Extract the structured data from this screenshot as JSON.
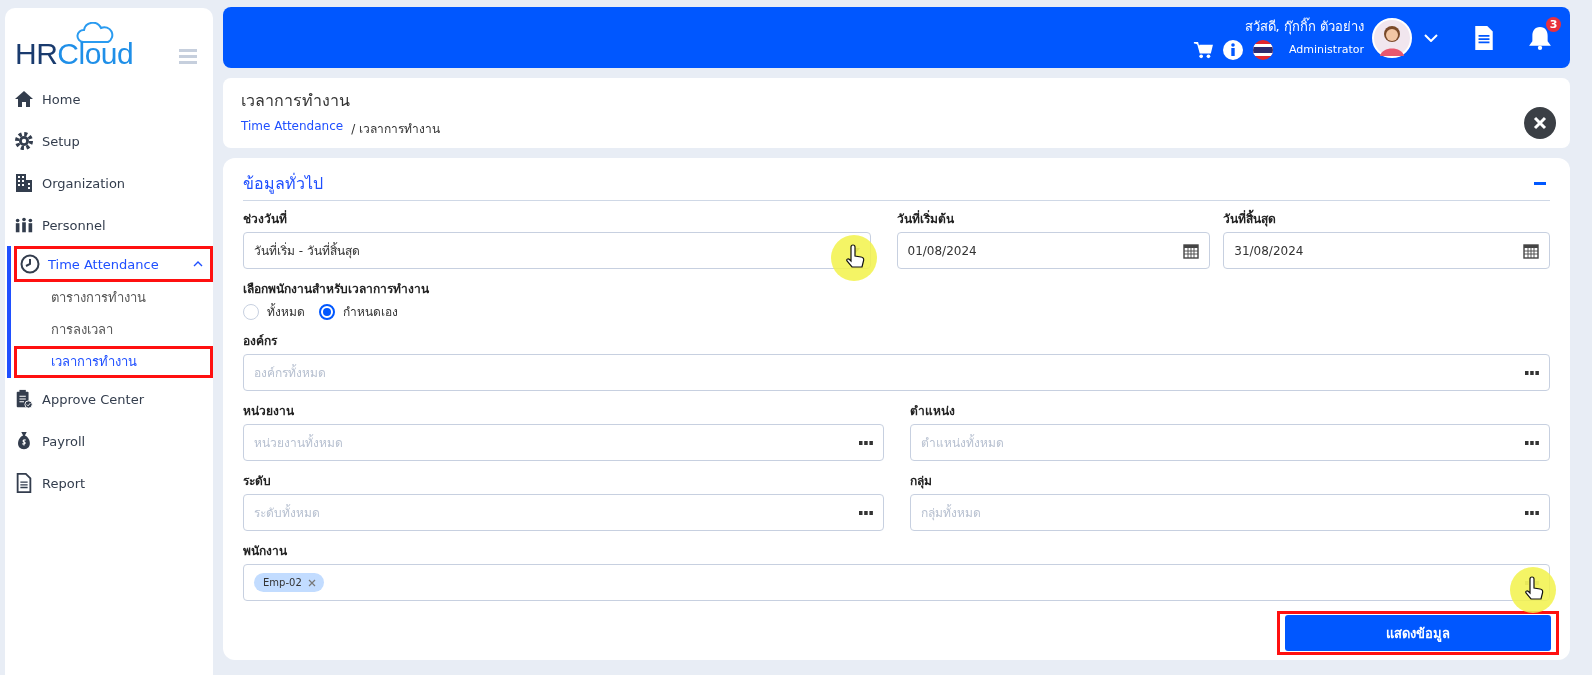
{
  "sidebar": {
    "logo": {
      "dark": "HR",
      "light": "Cloud"
    },
    "items": [
      {
        "label": "Home",
        "selected": false,
        "highlighted": false
      },
      {
        "label": "Setup",
        "selected": false,
        "highlighted": false
      },
      {
        "label": "Organization",
        "selected": false,
        "highlighted": false
      },
      {
        "label": "Personnel",
        "selected": false,
        "highlighted": false
      },
      {
        "label": "Time Attendance",
        "selected": true,
        "highlighted": true,
        "expanded": true,
        "children": [
          {
            "label": "ตารางการทำงาน",
            "selected": false,
            "highlighted": false
          },
          {
            "label": "การลงเวลา",
            "selected": false,
            "highlighted": false
          },
          {
            "label": "เวลาการทำงาน",
            "selected": true,
            "highlighted": true
          }
        ]
      },
      {
        "label": "Approve Center",
        "selected": false,
        "highlighted": false
      },
      {
        "label": "Payroll",
        "selected": false,
        "highlighted": false
      },
      {
        "label": "Report",
        "selected": false,
        "highlighted": false
      }
    ]
  },
  "header": {
    "greeting": "สวัสดี, กุ๊กกิ๊ก ตัวอย่าง",
    "role": "Administrator",
    "notifications": "3"
  },
  "page": {
    "title": "เวลาการทำงาน",
    "breadcrumb": [
      {
        "label": "Time Attendance",
        "link": true
      },
      {
        "label": "/ เวลาการทำงาน",
        "link": false
      }
    ]
  },
  "form": {
    "section_title": "ข้อมูลทั่วไป",
    "rows": [
      [
        {
          "kind": "select",
          "label": "ช่วงวันที่",
          "value": "วันที่เริ่ม - วันที่สิ้นสุด",
          "cursor": true
        },
        {
          "kind": "date",
          "label": "วันที่เริ่มต้น",
          "value": "01/08/2024"
        },
        {
          "kind": "date",
          "label": "วันที่สิ้นสุด",
          "value": "31/08/2024"
        }
      ],
      [
        {
          "kind": "radio",
          "label": "เลือกพนักงานสำหรับเวลาการทำงาน",
          "options": [
            {
              "label": "ทั้งหมด",
              "selected": false
            },
            {
              "label": "กำหนดเอง",
              "selected": true
            }
          ]
        }
      ],
      [
        {
          "kind": "picker",
          "label": "องค์กร",
          "placeholder": "องค์กรทั้งหมด"
        }
      ],
      [
        {
          "kind": "picker",
          "label": "หน่วยงาน",
          "placeholder": "หน่วยงานทั้งหมด"
        },
        {
          "kind": "picker",
          "label": "ตำแหน่ง",
          "placeholder": "ตำแหน่งทั้งหมด"
        }
      ],
      [
        {
          "kind": "picker",
          "label": "ระดับ",
          "placeholder": "ระดับทั้งหมด"
        },
        {
          "kind": "picker",
          "label": "กลุ่ม",
          "placeholder": "กลุ่มทั้งหมด"
        }
      ],
      [
        {
          "kind": "tags",
          "label": "พนักงาน",
          "tags": [
            "Emp-02"
          ],
          "cursor": true
        }
      ]
    ],
    "submit": {
      "label": "แสดงข้อมูล",
      "highlighted": true
    }
  }
}
